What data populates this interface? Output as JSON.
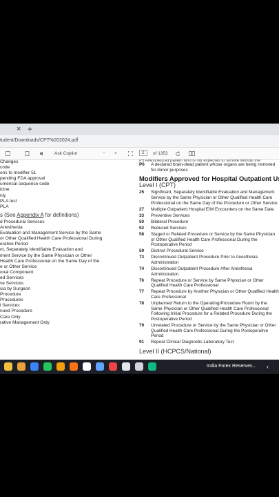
{
  "browser": {
    "close_glyph": "×",
    "new_tab_glyph": "+",
    "url": "tudent/Downloads/CPT%202024.pdf"
  },
  "pdf_toolbar": {
    "ask_copilot": "Ask Copilot",
    "zoom_out": "−",
    "zoom_in": "+",
    "page_current": "2",
    "page_total": "of 1352"
  },
  "left_column": {
    "rows_top": [
      "Changes",
      "code",
      "ons to modifier 51",
      "pending FDA approval",
      "umerical sequence code",
      "icine",
      "nly",
      "PLA test",
      "PLA"
    ],
    "section_prefix": "s (See ",
    "section_link": "Appendix A",
    "section_suffix": " for definitions)",
    "rows_bottom": [
      "d Procedural Services",
      "Anesthesia",
      "Evaluation and Management Service by the Same",
      "or Other Qualified Health Care Professional During",
      "erative Period",
      "nt, Separately Identifiable Evaluation and",
      "ment Service by the Same Physician or Other",
      "Health Care Professional on the Same Day of the",
      "e or Other Service",
      "onal Component",
      "ed Services",
      "ve Services",
      "sia by Surgeon",
      "Procedure",
      "Procedures",
      "l Services",
      "nued Procedure",
      "Care Only",
      "rative Management Only"
    ]
  },
  "right_column": {
    "partial_top": "P5  Anesthetized patient who is not expected to survive without the",
    "p6_code": "P6",
    "p6_text": "A declared brain-dead patient whose organs are being removed for donor purposes",
    "title": "Modifiers Approved for Hospital Outpatient Us",
    "level1": "Level I (CPT)",
    "modifiers": [
      {
        "code": "25",
        "text": "Significant, Separately Identifiable Evaluation and Management Service by the Same Physician or Other Qualified Health Care Professional on the Same Day of the Procedure or Other Service"
      },
      {
        "code": "27",
        "text": "Multiple Outpatient Hospital E/M Encounters on the Same Date"
      },
      {
        "code": "33",
        "text": "Preventive Services"
      },
      {
        "code": "50",
        "text": "Bilateral Procedure"
      },
      {
        "code": "52",
        "text": "Reduced Services"
      },
      {
        "code": "58",
        "text": "Staged or Related Procedure or Service by the Same Physician or Other Qualified Health Care Professional During the Postoperative Period"
      },
      {
        "code": "59",
        "text": "Distinct Procedural Service"
      },
      {
        "code": "73",
        "text": "Discontinued Outpatient Procedure Prior to Anesthesia Administration"
      },
      {
        "code": "74",
        "text": "Discontinued Outpatient Procedure After Anesthesia Administration"
      },
      {
        "code": "76",
        "text": "Repeat Procedure or Service by Same Physician or Other Qualified Health Care Professional"
      },
      {
        "code": "77",
        "text": "Repeat Procedure by Another Physician or Other Qualified Health Care Professional"
      },
      {
        "code": "78",
        "text": "Unplanned Return to the Operating/Procedure Room by the Same Physician or Other Qualified Health Care Professional Following Initial Procedure for a Related Procedure During the Postoperative Period"
      },
      {
        "code": "79",
        "text": "Unrelated Procedure or Service by the Same Physician or Other Qualified Health Care Professional During the Postoperative Period"
      },
      {
        "code": "91",
        "text": "Repeat Clinical Diagnostic Laboratory Test"
      }
    ],
    "level2": "Level II (HCPCS/National)"
  },
  "taskbar": {
    "news_text": "India Forex Reserves...",
    "chevron": "‹",
    "icon_colors": [
      "#f0c040",
      "#e9a23b",
      "#3b82f6",
      "#22c55e",
      "#f59e0b",
      "#f97316",
      "#ffffff",
      "#60a5fa",
      "#ef4444",
      "#e5e7eb",
      "#d1d5db",
      "#10b981"
    ]
  }
}
